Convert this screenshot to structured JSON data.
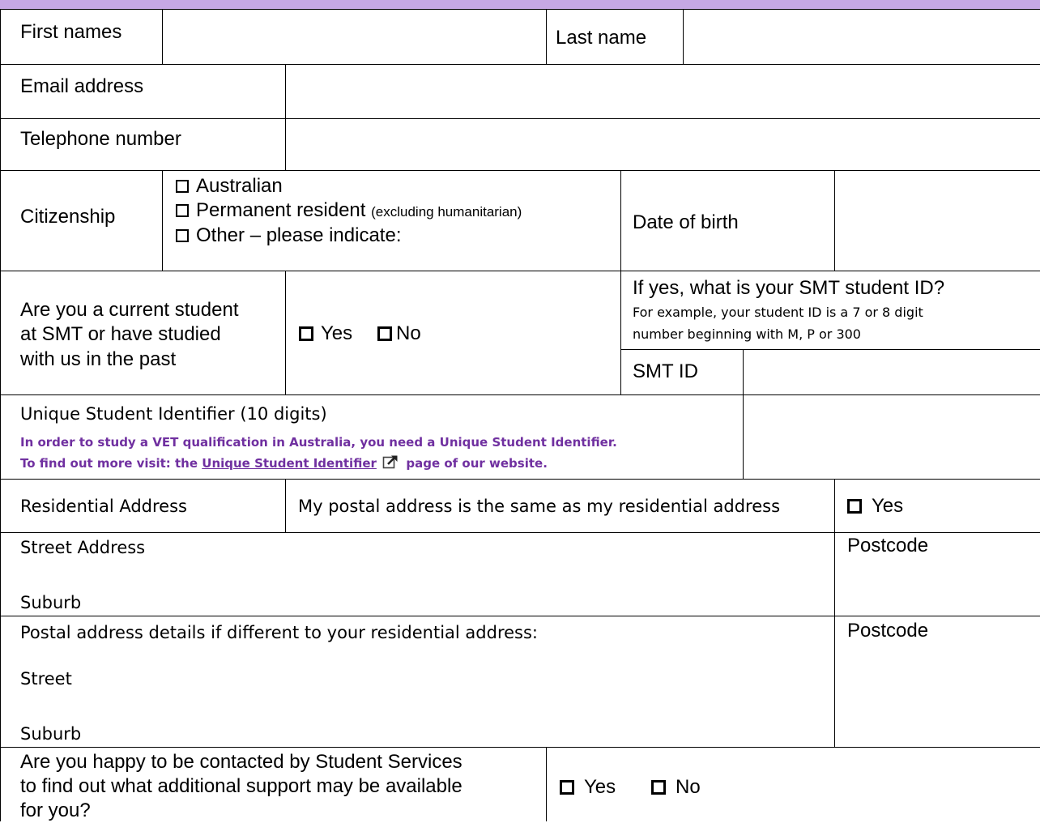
{
  "personal": {
    "first_names_label": "First names",
    "last_name_label": "Last name",
    "email_label": "Email address",
    "telephone_label": "Telephone number"
  },
  "citizenship": {
    "label": "Citizenship",
    "option_australian": "Australian",
    "option_permanent": "Permanent resident",
    "option_permanent_note": "(excluding humanitarian)",
    "option_other": "Other – please indicate:",
    "dob_label": "Date of birth"
  },
  "student": {
    "question_line1": "Are you a current student",
    "question_line2": "at SMT or have studied",
    "question_line3": "with us in the past",
    "yes_label": "Yes",
    "no_label": "No",
    "id_question": "If yes, what is your SMT student ID?",
    "id_hint_line1": "For example, your student ID is a 7 or 8 digit",
    "id_hint_line2": "number beginning with M, P or 300",
    "smt_id_label": "SMT ID"
  },
  "usi": {
    "label": "Unique Student Identifier (10 digits)",
    "note_line1": "In order to study a VET qualification in Australia, you need a Unique Student Identifier.",
    "note_line2_prefix": "To find out more visit: the",
    "link_text": "Unique Student Identifier",
    "note_line2_suffix": "page of our website."
  },
  "address": {
    "residential_label": "Residential Address",
    "same_postal_text": "My postal address is the same as my residential address",
    "yes_label": "Yes",
    "street_address_label": "Street Address",
    "suburb_label": "Suburb",
    "postcode_label": "Postcode",
    "postal_intro": "Postal address details if different to your residential address:",
    "postal_street_label": "Street",
    "postal_suburb_label": "Suburb",
    "postal_postcode_label": "Postcode"
  },
  "support": {
    "question_line1": "Are you happy to be contacted by Student Services",
    "question_line2": "to find out what additional support may be available",
    "question_line3": "for you?",
    "yes_label": "Yes",
    "no_label": "No"
  },
  "colors": {
    "header_band": "#c6a8e4",
    "note_purple": "#7030a0"
  }
}
